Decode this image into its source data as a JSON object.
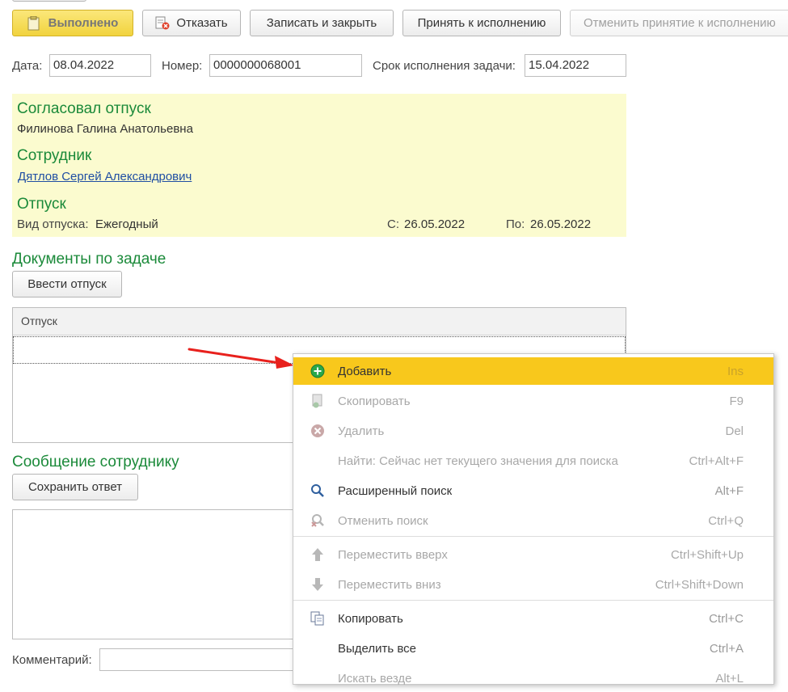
{
  "toolbar": {
    "done": "Выполнено",
    "refuse": "Отказать",
    "save_close": "Записать и закрыть",
    "accept": "Принять к исполнению",
    "cancel_accept": "Отменить принятие к исполнению"
  },
  "header": {
    "date_label": "Дата:",
    "date_value": "08.04.2022",
    "number_label": "Номер:",
    "number_value": "0000000068001",
    "deadline_label": "Срок исполнения задачи:",
    "deadline_value": "15.04.2022"
  },
  "panel": {
    "approved_title": "Согласовал отпуск",
    "approved_name": "Филинова Галина Анатольевна",
    "employee_title": "Сотрудник",
    "employee_name": "Дятлов Сергей Александрович",
    "vacation_title": "Отпуск",
    "type_label": "Вид отпуска:",
    "type_value": "Ежегодный",
    "from_label": "С:",
    "from_value": "26.05.2022",
    "to_label": "По:",
    "to_value": "26.05.2022"
  },
  "documents": {
    "title": "Документы по задаче",
    "enter_button": "Ввести отпуск",
    "column": "Отпуск"
  },
  "message": {
    "title": "Сообщение сотруднику",
    "save_button": "Сохранить ответ",
    "comment_label": "Комментарий:"
  },
  "context_menu": {
    "items": [
      {
        "label": "Добавить",
        "shortcut": "Ins",
        "icon": "add-icon",
        "enabled": true,
        "highlighted": true
      },
      {
        "label": "Скопировать",
        "shortcut": "F9",
        "icon": "copy-document-icon",
        "enabled": false
      },
      {
        "label": "Удалить",
        "shortcut": "Del",
        "icon": "delete-icon",
        "enabled": false
      },
      {
        "label": "Найти: Сейчас нет текущего значения для поиска",
        "shortcut": "Ctrl+Alt+F",
        "icon": "",
        "enabled": false
      },
      {
        "label": "Расширенный поиск",
        "shortcut": "Alt+F",
        "icon": "search-icon",
        "enabled": true
      },
      {
        "label": "Отменить поиск",
        "shortcut": "Ctrl+Q",
        "icon": "cancel-search-icon",
        "enabled": false
      },
      {
        "label": "Переместить вверх",
        "shortcut": "Ctrl+Shift+Up",
        "icon": "arrow-up-icon",
        "enabled": false
      },
      {
        "label": "Переместить вниз",
        "shortcut": "Ctrl+Shift+Down",
        "icon": "arrow-down-icon",
        "enabled": false
      },
      {
        "label": "Копировать",
        "shortcut": "Ctrl+C",
        "icon": "clipboard-copy-icon",
        "enabled": true
      },
      {
        "label": "Выделить все",
        "shortcut": "Ctrl+A",
        "icon": "",
        "enabled": true
      },
      {
        "label": "Искать везде",
        "shortcut": "Alt+L",
        "icon": "",
        "enabled": false
      }
    ]
  },
  "colors": {
    "accent_green": "#1b8a3a",
    "highlight_yellow": "#f8c81c",
    "panel_yellow": "#fbfbcf",
    "arrow_red": "#e8211d"
  }
}
